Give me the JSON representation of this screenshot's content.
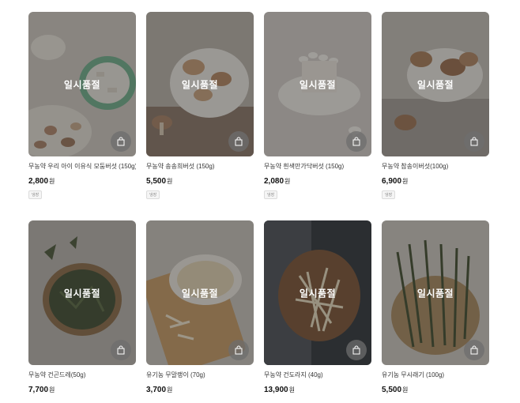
{
  "sold_out_label": "일시품절",
  "currency": "원",
  "products": [
    {
      "name": "무농약 우리 아이 이유식 모둠버섯 (150g)",
      "price": "2,800",
      "tag": "냉장"
    },
    {
      "name": "무농약 송송희버섯 (150g)",
      "price": "5,500",
      "tag": "냉장"
    },
    {
      "name": "무농약 흰색만가닥버섯 (150g)",
      "price": "2,080",
      "tag": "냉장"
    },
    {
      "name": "무농약 참송이버섯(100g)",
      "price": "6,900",
      "tag": "냉장"
    },
    {
      "name": "무농약 건곤드레(50g)",
      "price": "7,700",
      "tag": ""
    },
    {
      "name": "유기농 무말랭이 (70g)",
      "price": "3,700",
      "tag": ""
    },
    {
      "name": "무농약 건도라지 (40g)",
      "price": "13,900",
      "tag": ""
    },
    {
      "name": "유기농 무시래기 (100g)",
      "price": "5,500",
      "tag": ""
    }
  ]
}
